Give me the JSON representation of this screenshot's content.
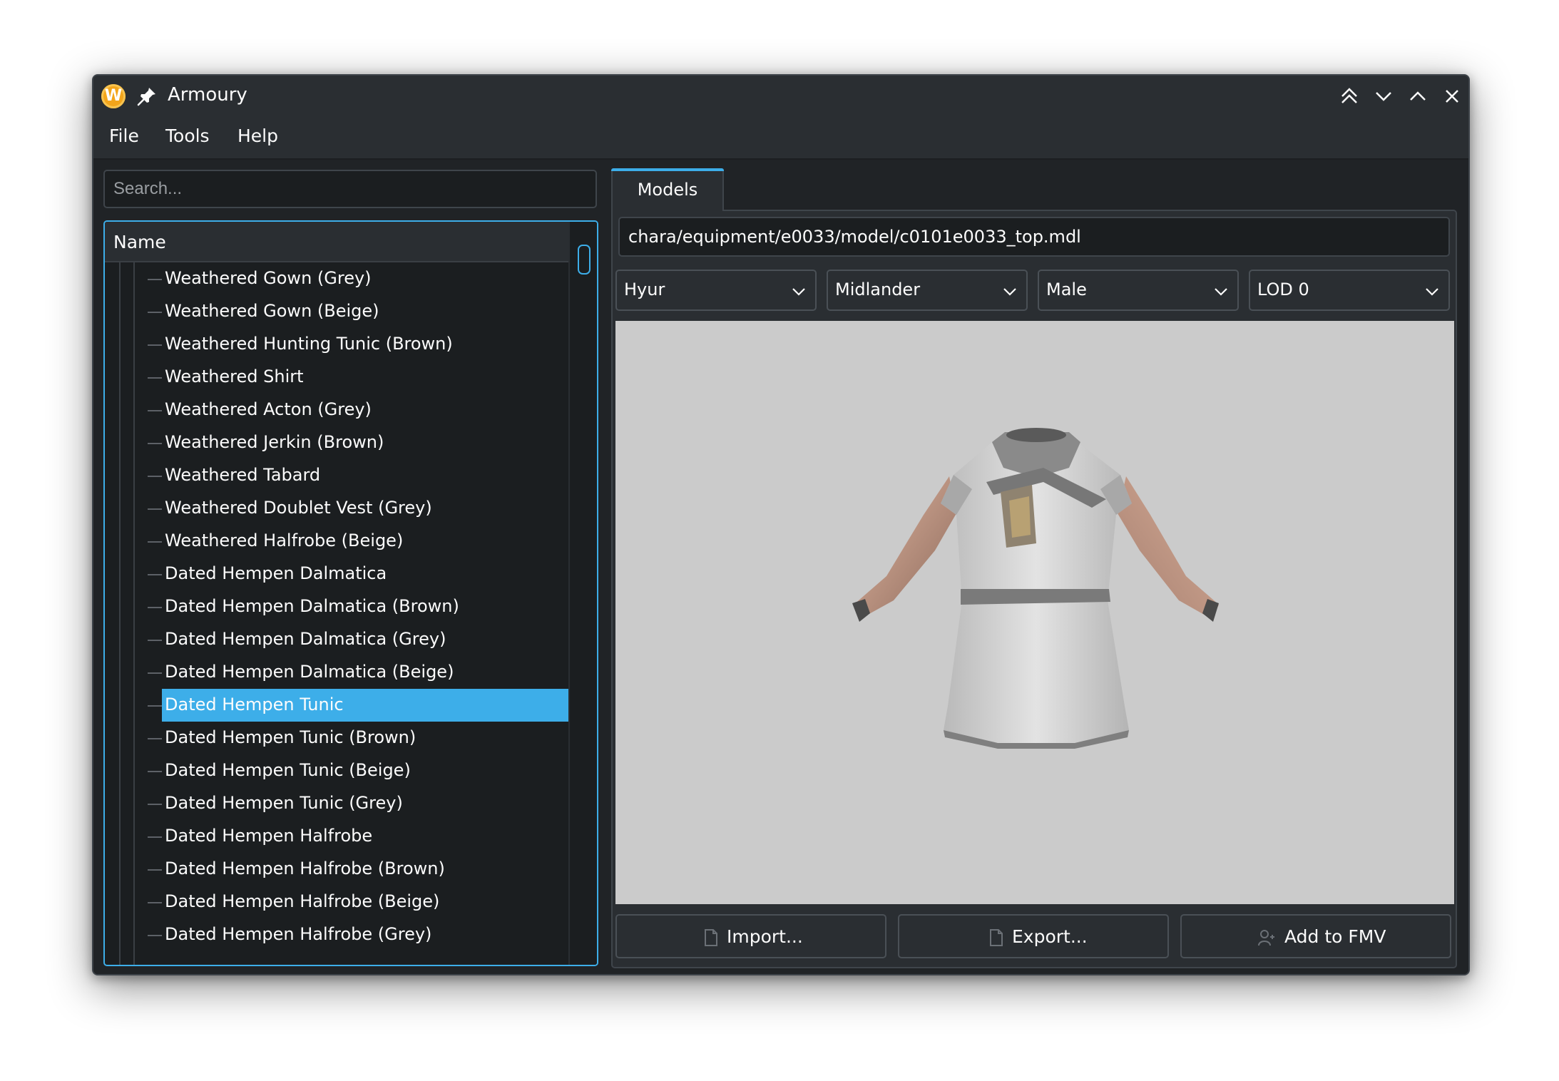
{
  "window": {
    "title": "Armoury",
    "app_icon_letter": "W",
    "accent_color": "#3daee9"
  },
  "menu": {
    "file": "File",
    "tools": "Tools",
    "help": "Help"
  },
  "sidebar": {
    "search_placeholder": "Search...",
    "column_header": "Name",
    "items": [
      {
        "label": "Weathered Gown (Grey)"
      },
      {
        "label": "Weathered Gown (Beige)"
      },
      {
        "label": "Weathered Hunting Tunic (Brown)"
      },
      {
        "label": "Weathered Shirt"
      },
      {
        "label": "Weathered Acton (Grey)"
      },
      {
        "label": "Weathered Jerkin (Brown)"
      },
      {
        "label": "Weathered Tabard"
      },
      {
        "label": "Weathered Doublet Vest (Grey)"
      },
      {
        "label": "Weathered Halfrobe (Beige)"
      },
      {
        "label": "Dated Hempen Dalmatica"
      },
      {
        "label": "Dated Hempen Dalmatica (Brown)"
      },
      {
        "label": "Dated Hempen Dalmatica (Grey)"
      },
      {
        "label": "Dated Hempen Dalmatica (Beige)"
      },
      {
        "label": "Dated Hempen Tunic"
      },
      {
        "label": "Dated Hempen Tunic (Brown)"
      },
      {
        "label": "Dated Hempen Tunic (Beige)"
      },
      {
        "label": "Dated Hempen Tunic (Grey)"
      },
      {
        "label": "Dated Hempen Halfrobe"
      },
      {
        "label": "Dated Hempen Halfrobe (Brown)"
      },
      {
        "label": "Dated Hempen Halfrobe (Beige)"
      },
      {
        "label": "Dated Hempen Halfrobe (Grey)"
      }
    ],
    "selected_index": 13
  },
  "main": {
    "tab_label": "Models",
    "model_path": "chara/equipment/e0033/model/c0101e0033_top.mdl",
    "race": "Hyur",
    "subrace": "Midlander",
    "gender": "Male",
    "lod": "LOD 0",
    "buttons": {
      "import": "Import...",
      "export": "Export...",
      "add_to_fmv": "Add to FMV"
    }
  }
}
